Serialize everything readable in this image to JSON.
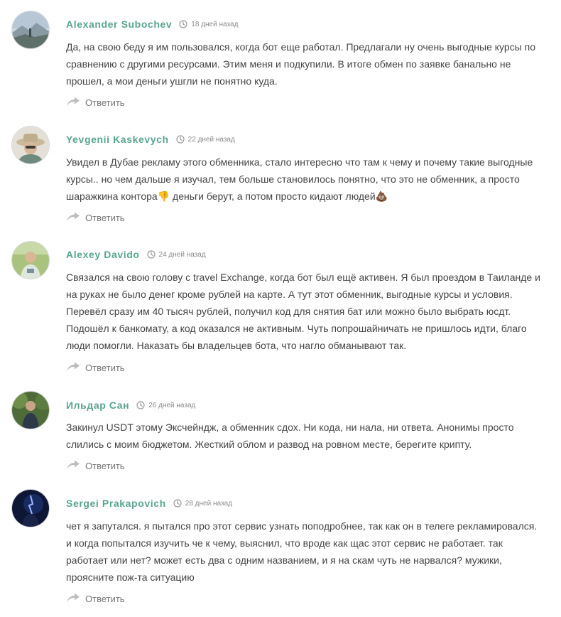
{
  "colors": {
    "author": "#59a58f",
    "meta": "#8a8a8a",
    "text": "#444444"
  },
  "comments": [
    {
      "author": "Alexander Subochev",
      "time": "18 дней назад",
      "avatar": "mountain-landscape-photo",
      "lines": [
        "Да, на свою беду я им пользовался, когда бот еще работал. Предлагали ну очень выгодные курсы по",
        "сравнению с другими ресурсами. Этим меня и подкупили. В итоге обмен по заявке банально не",
        "прошел, а мои деньги ушгли не понятно куда."
      ],
      "reply": "Ответить"
    },
    {
      "author": "Yevgenii Kaskevych",
      "time": "22 дней назад",
      "avatar": "man-in-hat-photo",
      "lines": [
        "Увидел в Дубае рекламу этого обменника, стало интересно что там к чему и почему такие выгодные",
        "курсы.. но чем дальше я изучал, тем больше становилось понятно, что это не обменник, а просто",
        "шаражкина контора👎 деньги берут, а потом просто кидают людей💩"
      ],
      "reply": "Ответить"
    },
    {
      "author": "Alexey Davido",
      "time": "24 дней назад",
      "avatar": "person-outdoors-photo",
      "lines": [
        "Связался на свою голову с travel Exchange, когда бот был ещё активен. Я был проездом в Таиланде и",
        "на руках не было денег кроме рублей на карте. А тут этот обменник, выгодные курсы и условия.",
        "Перевёл сразу им 40 тысяч рублей, получил код для снятия бат или можно было выбрать юсдт.",
        "Подошёл к банкомату, а код оказался не активным. Чуть попрошайничать не пришлось идти, благо",
        "люди помогли. Наказать бы владельцев бота, что нагло обманывают так."
      ],
      "reply": "Ответить"
    },
    {
      "author": "Ильдар Сан",
      "time": "26 дней назад",
      "avatar": "person-in-forest-photo",
      "lines": [
        "Закинул USDT этому Эксчейндж, а обменник сдох. Ни кода, ни нала, ни ответа. Анонимы просто",
        "слились с моим бюджетом. Жесткий облом и развод на ровном месте, берегите крипту."
      ],
      "reply": "Ответить"
    },
    {
      "author": "Sergei Prakapovich",
      "time": "28 дней назад",
      "avatar": "dark-blue-portrait-photo",
      "lines": [
        "чет я запутался. я пытался про этот сервис узнать поподробнее, так как он в телеге рекламировался.",
        "и когда попытался изучить че к чему, выяснил, что вроде как щас этот сервис не работает. так",
        "работает или нет? может есть два с одним названием, и я на скам чуть не нарвался? мужики,",
        "проясните пож-та ситуацию"
      ],
      "reply": "Ответить"
    }
  ]
}
